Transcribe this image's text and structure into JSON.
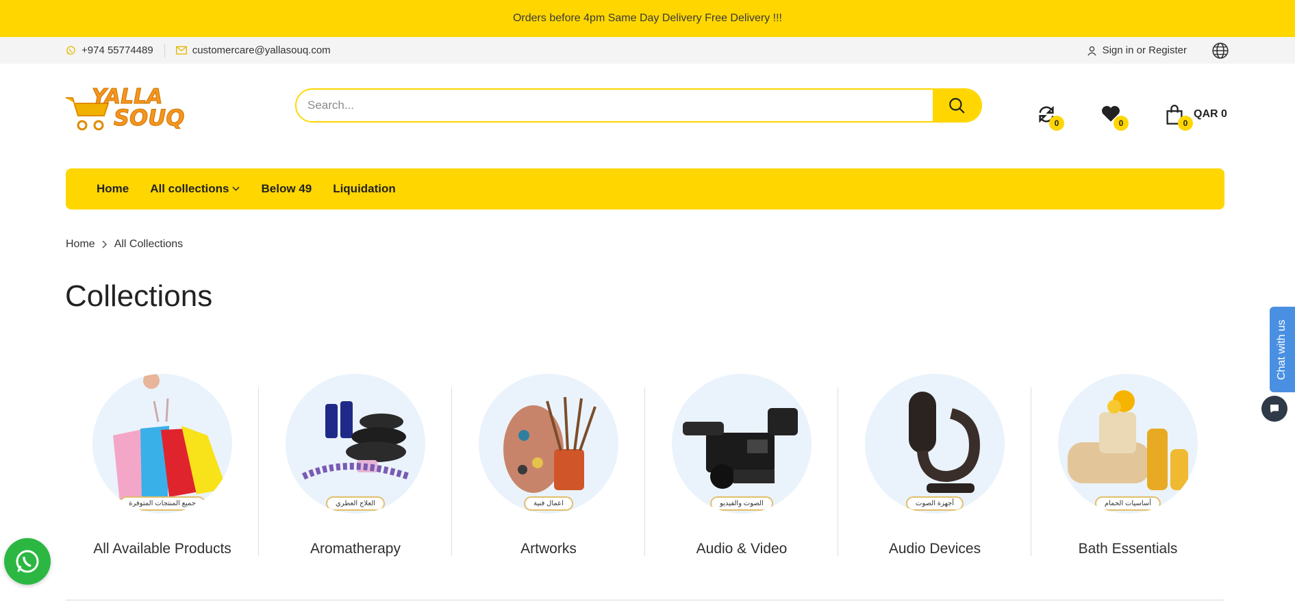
{
  "announcement": "Orders before 4pm Same Day Delivery Free Delivery !!!",
  "topbar": {
    "phone": "+974 55774489",
    "email": "customercare@yallasouq.com",
    "signin": "Sign in or Register"
  },
  "logo": {
    "line1": "YALLA",
    "line2": "SOUQ"
  },
  "search": {
    "placeholder": "Search..."
  },
  "header": {
    "compare_count": "0",
    "wishlist_count": "0",
    "cart_count": "0",
    "cart_total": "QAR 0"
  },
  "nav": {
    "items": [
      "Home",
      "All collections",
      "Below 49",
      "Liquidation"
    ]
  },
  "breadcrumb": {
    "home": "Home",
    "current": "All Collections"
  },
  "page_title": "Collections",
  "collections": [
    {
      "label": "All Available Products",
      "badge": "جميع المنتجات المتوفرة"
    },
    {
      "label": "Aromatherapy",
      "badge": "العلاج العطري"
    },
    {
      "label": "Artworks",
      "badge": "اعمال فنية"
    },
    {
      "label": "Audio & Video",
      "badge": "الصوت والفيديو"
    },
    {
      "label": "Audio Devices",
      "badge": "أجهزة الصوت"
    },
    {
      "label": "Bath Essentials",
      "badge": "أساسيات الحمام"
    }
  ],
  "chat": {
    "tab_label": "Chat with us"
  },
  "colors": {
    "brand_yellow": "#ffd600",
    "whatsapp_green": "#2cb742",
    "chat_blue": "#4a90e2"
  }
}
